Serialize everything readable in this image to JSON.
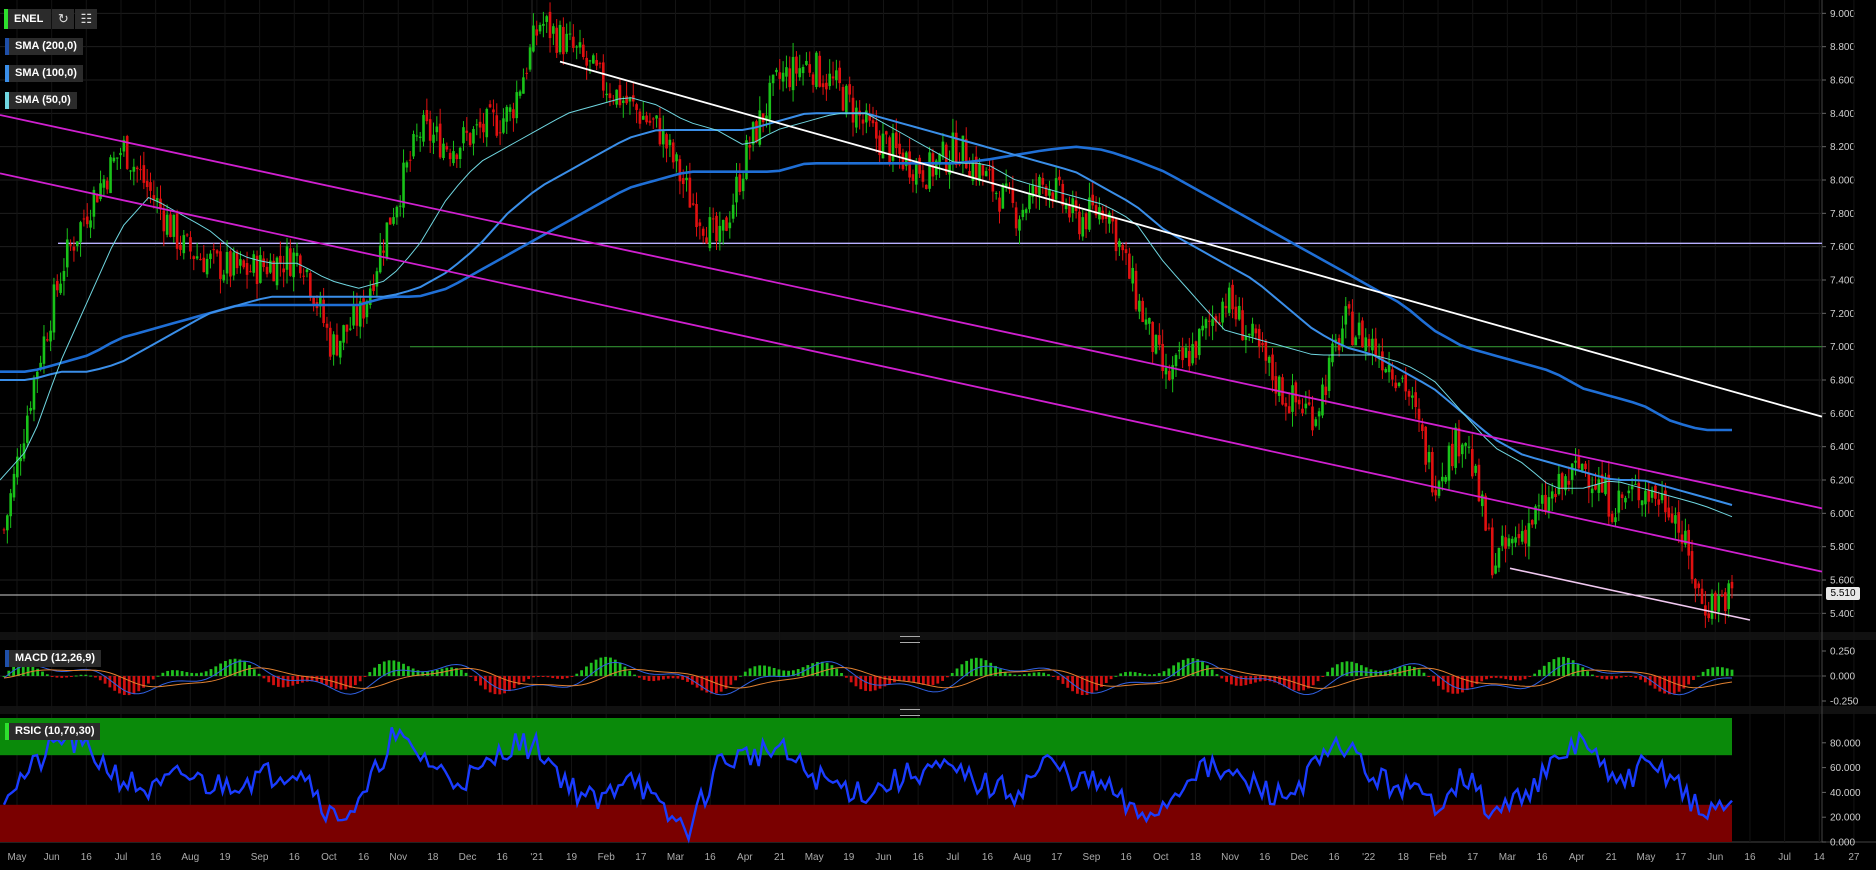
{
  "toolbar": {
    "symbol": "ENEL",
    "refresh_icon": "refresh-icon",
    "settings_icon": "chart-settings-icon"
  },
  "indicators": {
    "sma200": "SMA (200,0)",
    "sma100": "SMA (100,0)",
    "sma50": "SMA (50,0)",
    "macd": "MACD (12,26,9)",
    "rsic": "RSIC (10,70,30)"
  },
  "last_price_label": "5.510",
  "colors": {
    "up": "#19c219",
    "down": "#e01010",
    "sma200": "#1f6fd6",
    "sma100": "#3a8ee8",
    "sma50": "#6fd6e0",
    "channel": "#d020d0",
    "trend": "#ffffff",
    "horizontal_violet": "#b8b0ff",
    "horizontal_green": "#2e8b2e",
    "rsi_line": "#1a3cff",
    "rsi_overbought": "#0a8a0a",
    "rsi_oversold": "#7a0000",
    "macd_pos": "#20c020",
    "macd_neg": "#d01010",
    "macd_line": "#3060e0",
    "signal_line": "#e08030"
  },
  "chart_data": [
    {
      "type": "candlestick",
      "title": "ENEL",
      "y_ticks": [
        "9.000",
        "8.800",
        "8.600",
        "8.400",
        "8.200",
        "8.000",
        "7.800",
        "7.600",
        "7.400",
        "7.200",
        "7.000",
        "6.800",
        "6.600",
        "6.400",
        "6.200",
        "6.000",
        "5.800",
        "5.600",
        "5.400"
      ],
      "ylim": [
        5.3,
        9.05
      ],
      "x_ticks": [
        "May",
        "Jun",
        "16",
        "Jul",
        "16",
        "Aug",
        "19",
        "Sep",
        "16",
        "Oct",
        "16",
        "Nov",
        "18",
        "Dec",
        "16",
        "'21",
        "19",
        "Feb",
        "17",
        "Mar",
        "16",
        "Apr",
        "21",
        "May",
        "19",
        "Jun",
        "16",
        "Jul",
        "16",
        "Aug",
        "17",
        "Sep",
        "16",
        "Oct",
        "18",
        "Nov",
        "16",
        "Dec",
        "16",
        "'22",
        "18",
        "Feb",
        "17",
        "Mar",
        "16",
        "Apr",
        "21",
        "May",
        "17",
        "Jun",
        "16",
        "Jul",
        "14",
        "27"
      ],
      "close_series_approx": {
        "dates": [
          "2020-05-15",
          "2020-06-01",
          "2020-06-15",
          "2020-07-01",
          "2020-07-16",
          "2020-08-03",
          "2020-08-20",
          "2020-09-07",
          "2020-09-21",
          "2020-10-05",
          "2020-10-19",
          "2020-10-30",
          "2020-11-05",
          "2020-11-10",
          "2020-11-20",
          "2020-12-01",
          "2020-12-15",
          "2021-01-04",
          "2021-01-08",
          "2021-01-15",
          "2021-01-22",
          "2021-02-01",
          "2021-02-15",
          "2021-03-01",
          "2021-03-04",
          "2021-03-16",
          "2021-04-01",
          "2021-04-15",
          "2021-04-22",
          "2021-05-03",
          "2021-05-19",
          "2021-06-01",
          "2021-06-16",
          "2021-07-01",
          "2021-07-16",
          "2021-08-02",
          "2021-08-17",
          "2021-09-01",
          "2021-09-16",
          "2021-10-01",
          "2021-10-18",
          "2021-11-01",
          "2021-11-16",
          "2021-12-01",
          "2021-12-16",
          "2022-01-04",
          "2022-01-18",
          "2022-02-01",
          "2022-02-17",
          "2022-03-01",
          "2022-03-08",
          "2022-03-16",
          "2022-04-01",
          "2022-04-21",
          "2022-05-03",
          "2022-05-17",
          "2022-06-01",
          "2022-06-13",
          "2022-06-20"
        ],
        "close": [
          5.9,
          6.8,
          7.5,
          7.9,
          8.2,
          7.9,
          7.6,
          7.5,
          7.45,
          7.5,
          7.55,
          7.0,
          7.2,
          7.8,
          8.3,
          8.2,
          8.3,
          8.4,
          8.95,
          8.8,
          8.6,
          8.45,
          8.3,
          7.9,
          7.6,
          8.2,
          8.6,
          8.7,
          8.55,
          8.3,
          8.15,
          8.05,
          8.2,
          8.0,
          7.8,
          8.0,
          7.75,
          7.85,
          7.3,
          6.8,
          7.0,
          7.3,
          7.0,
          6.7,
          6.6,
          7.15,
          7.0,
          6.8,
          6.2,
          6.5,
          5.7,
          5.9,
          6.1,
          6.3,
          6.05,
          6.15,
          6.05,
          5.45,
          5.51
        ]
      },
      "sma50_approx": [
        6.2,
        6.4,
        6.9,
        7.3,
        7.7,
        7.9,
        7.8,
        7.7,
        7.55,
        7.5,
        7.5,
        7.4,
        7.35,
        7.4,
        7.6,
        7.9,
        8.1,
        8.2,
        8.3,
        8.4,
        8.45,
        8.5,
        8.45,
        8.35,
        8.3,
        8.2,
        8.3,
        8.35,
        8.4,
        8.4,
        8.3,
        8.2,
        8.1,
        8.1,
        8.0,
        7.95,
        7.9,
        7.85,
        7.75,
        7.5,
        7.3,
        7.1,
        7.05,
        7.0,
        6.95,
        6.95,
        6.95,
        6.9,
        6.8,
        6.6,
        6.4,
        6.3,
        6.15,
        6.15,
        6.2,
        6.15,
        6.1,
        6.05,
        5.98
      ],
      "sma100_approx": [
        6.8,
        6.8,
        6.85,
        6.85,
        6.9,
        7.0,
        7.1,
        7.2,
        7.25,
        7.3,
        7.3,
        7.3,
        7.3,
        7.3,
        7.35,
        7.45,
        7.6,
        7.8,
        7.95,
        8.05,
        8.15,
        8.25,
        8.3,
        8.3,
        8.3,
        8.3,
        8.35,
        8.4,
        8.4,
        8.4,
        8.35,
        8.3,
        8.25,
        8.2,
        8.15,
        8.1,
        8.05,
        7.95,
        7.85,
        7.7,
        7.6,
        7.5,
        7.4,
        7.25,
        7.1,
        7.0,
        6.95,
        6.85,
        6.75,
        6.6,
        6.45,
        6.35,
        6.3,
        6.25,
        6.2,
        6.2,
        6.15,
        6.1,
        6.05
      ],
      "sma200_approx": [
        6.85,
        6.85,
        6.9,
        6.95,
        7.05,
        7.1,
        7.15,
        7.2,
        7.25,
        7.25,
        7.25,
        7.25,
        7.25,
        7.3,
        7.3,
        7.35,
        7.45,
        7.55,
        7.65,
        7.75,
        7.85,
        7.95,
        8.0,
        8.05,
        8.05,
        8.05,
        8.05,
        8.1,
        8.1,
        8.1,
        8.1,
        8.1,
        8.1,
        8.12,
        8.15,
        8.18,
        8.2,
        8.18,
        8.12,
        8.05,
        7.95,
        7.85,
        7.75,
        7.65,
        7.55,
        7.45,
        7.35,
        7.25,
        7.1,
        7.0,
        6.95,
        6.9,
        6.85,
        6.75,
        6.7,
        6.65,
        6.55,
        6.5,
        6.5
      ],
      "horizontal_levels": [
        7.62,
        7.0,
        5.51
      ],
      "last_price": 5.51
    },
    {
      "type": "macd",
      "title": "MACD (12,26,9)",
      "y_ticks": [
        "0.250",
        "0.000",
        "-0.250"
      ],
      "ylim": [
        -0.3,
        0.3
      ]
    },
    {
      "type": "rsi",
      "title": "RSIC (10,70,30)",
      "y_ticks": [
        "80.000",
        "60.000",
        "40.000",
        "20.000",
        "0.000"
      ],
      "ylim": [
        0,
        100
      ],
      "overbought": 70,
      "oversold": 30,
      "rsi_approx": [
        40,
        60,
        85,
        70,
        50,
        40,
        55,
        45,
        50,
        55,
        60,
        20,
        30,
        85,
        70,
        50,
        55,
        80,
        75,
        45,
        30,
        60,
        25,
        10,
        65,
        70,
        75,
        55,
        45,
        40,
        50,
        60,
        55,
        45,
        40,
        65,
        50,
        45,
        20,
        30,
        60,
        55,
        45,
        35,
        60,
        80,
        50,
        45,
        30,
        55,
        20,
        40,
        60,
        85,
        45,
        60,
        55,
        20,
        35
      ]
    }
  ]
}
